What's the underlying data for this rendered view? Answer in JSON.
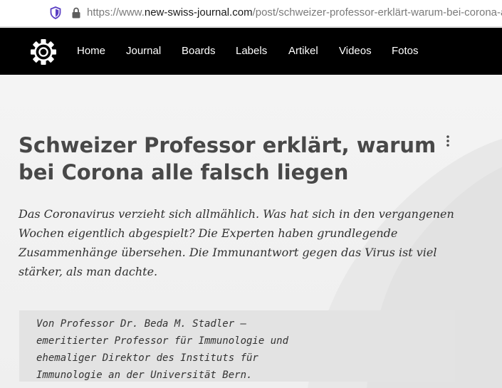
{
  "browser": {
    "url_prefix": "https://www.",
    "url_host": "new-swiss-journal.com",
    "url_path": "/post/schweizer-professor-erklärt-warum-bei-corona-alle-fa"
  },
  "nav": {
    "items": [
      {
        "label": "Home"
      },
      {
        "label": "Journal"
      },
      {
        "label": "Boards"
      },
      {
        "label": "Labels"
      },
      {
        "label": "Artikel"
      },
      {
        "label": "Videos"
      },
      {
        "label": "Fotos"
      }
    ]
  },
  "article": {
    "title": "Schweizer Professor erklärt, warum bei Corona alle falsch liegen",
    "lead": "Das Coronavirus verzieht sich allmählich. Was hat sich in den vergangenen Wochen eigentlich abgespielt? Die Experten haben grundlegende Zusammenhänge übersehen. Die Immunantwort gegen das Virus ist viel stärker, als man dachte.",
    "author_lines": [
      "Von Professor Dr. Beda M. Stadler –",
      "emeritierter Professor für Immunologie und",
      "ehemaliger Direktor des Instituts für",
      "Immunologie an der Universität Bern."
    ]
  }
}
